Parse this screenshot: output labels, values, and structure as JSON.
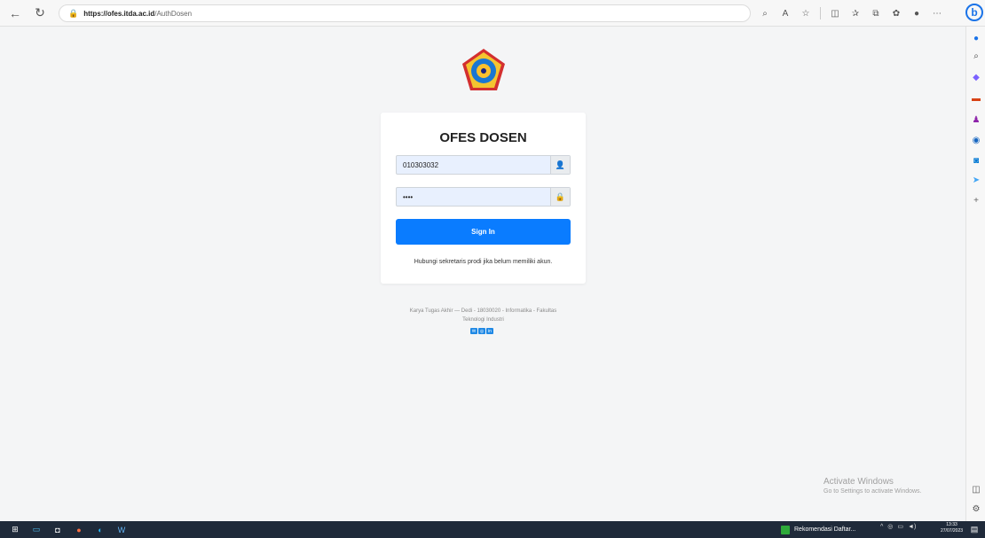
{
  "browser": {
    "url_host": "https://ofes.itda.ac.id",
    "url_path": "/AuthDosen",
    "bing_label": "b"
  },
  "login": {
    "title": "OFES DOSEN",
    "username_value": "010303032",
    "password_value": "••••",
    "signin_label": "Sign In",
    "hint": "Hubungi sekretaris prodi jika belum memiliki akun."
  },
  "footer": {
    "line1": "Karya Tugas Akhir — Dedi - 18030020 - Informatika - Fakultas",
    "line2": "Teknologi Industri"
  },
  "watermark": {
    "title": "Activate Windows",
    "subtitle": "Go to Settings to activate Windows."
  },
  "taskbar": {
    "app_label": "Rekomendasi Daftar...",
    "time": "13:33",
    "date": "27/07/2023"
  }
}
